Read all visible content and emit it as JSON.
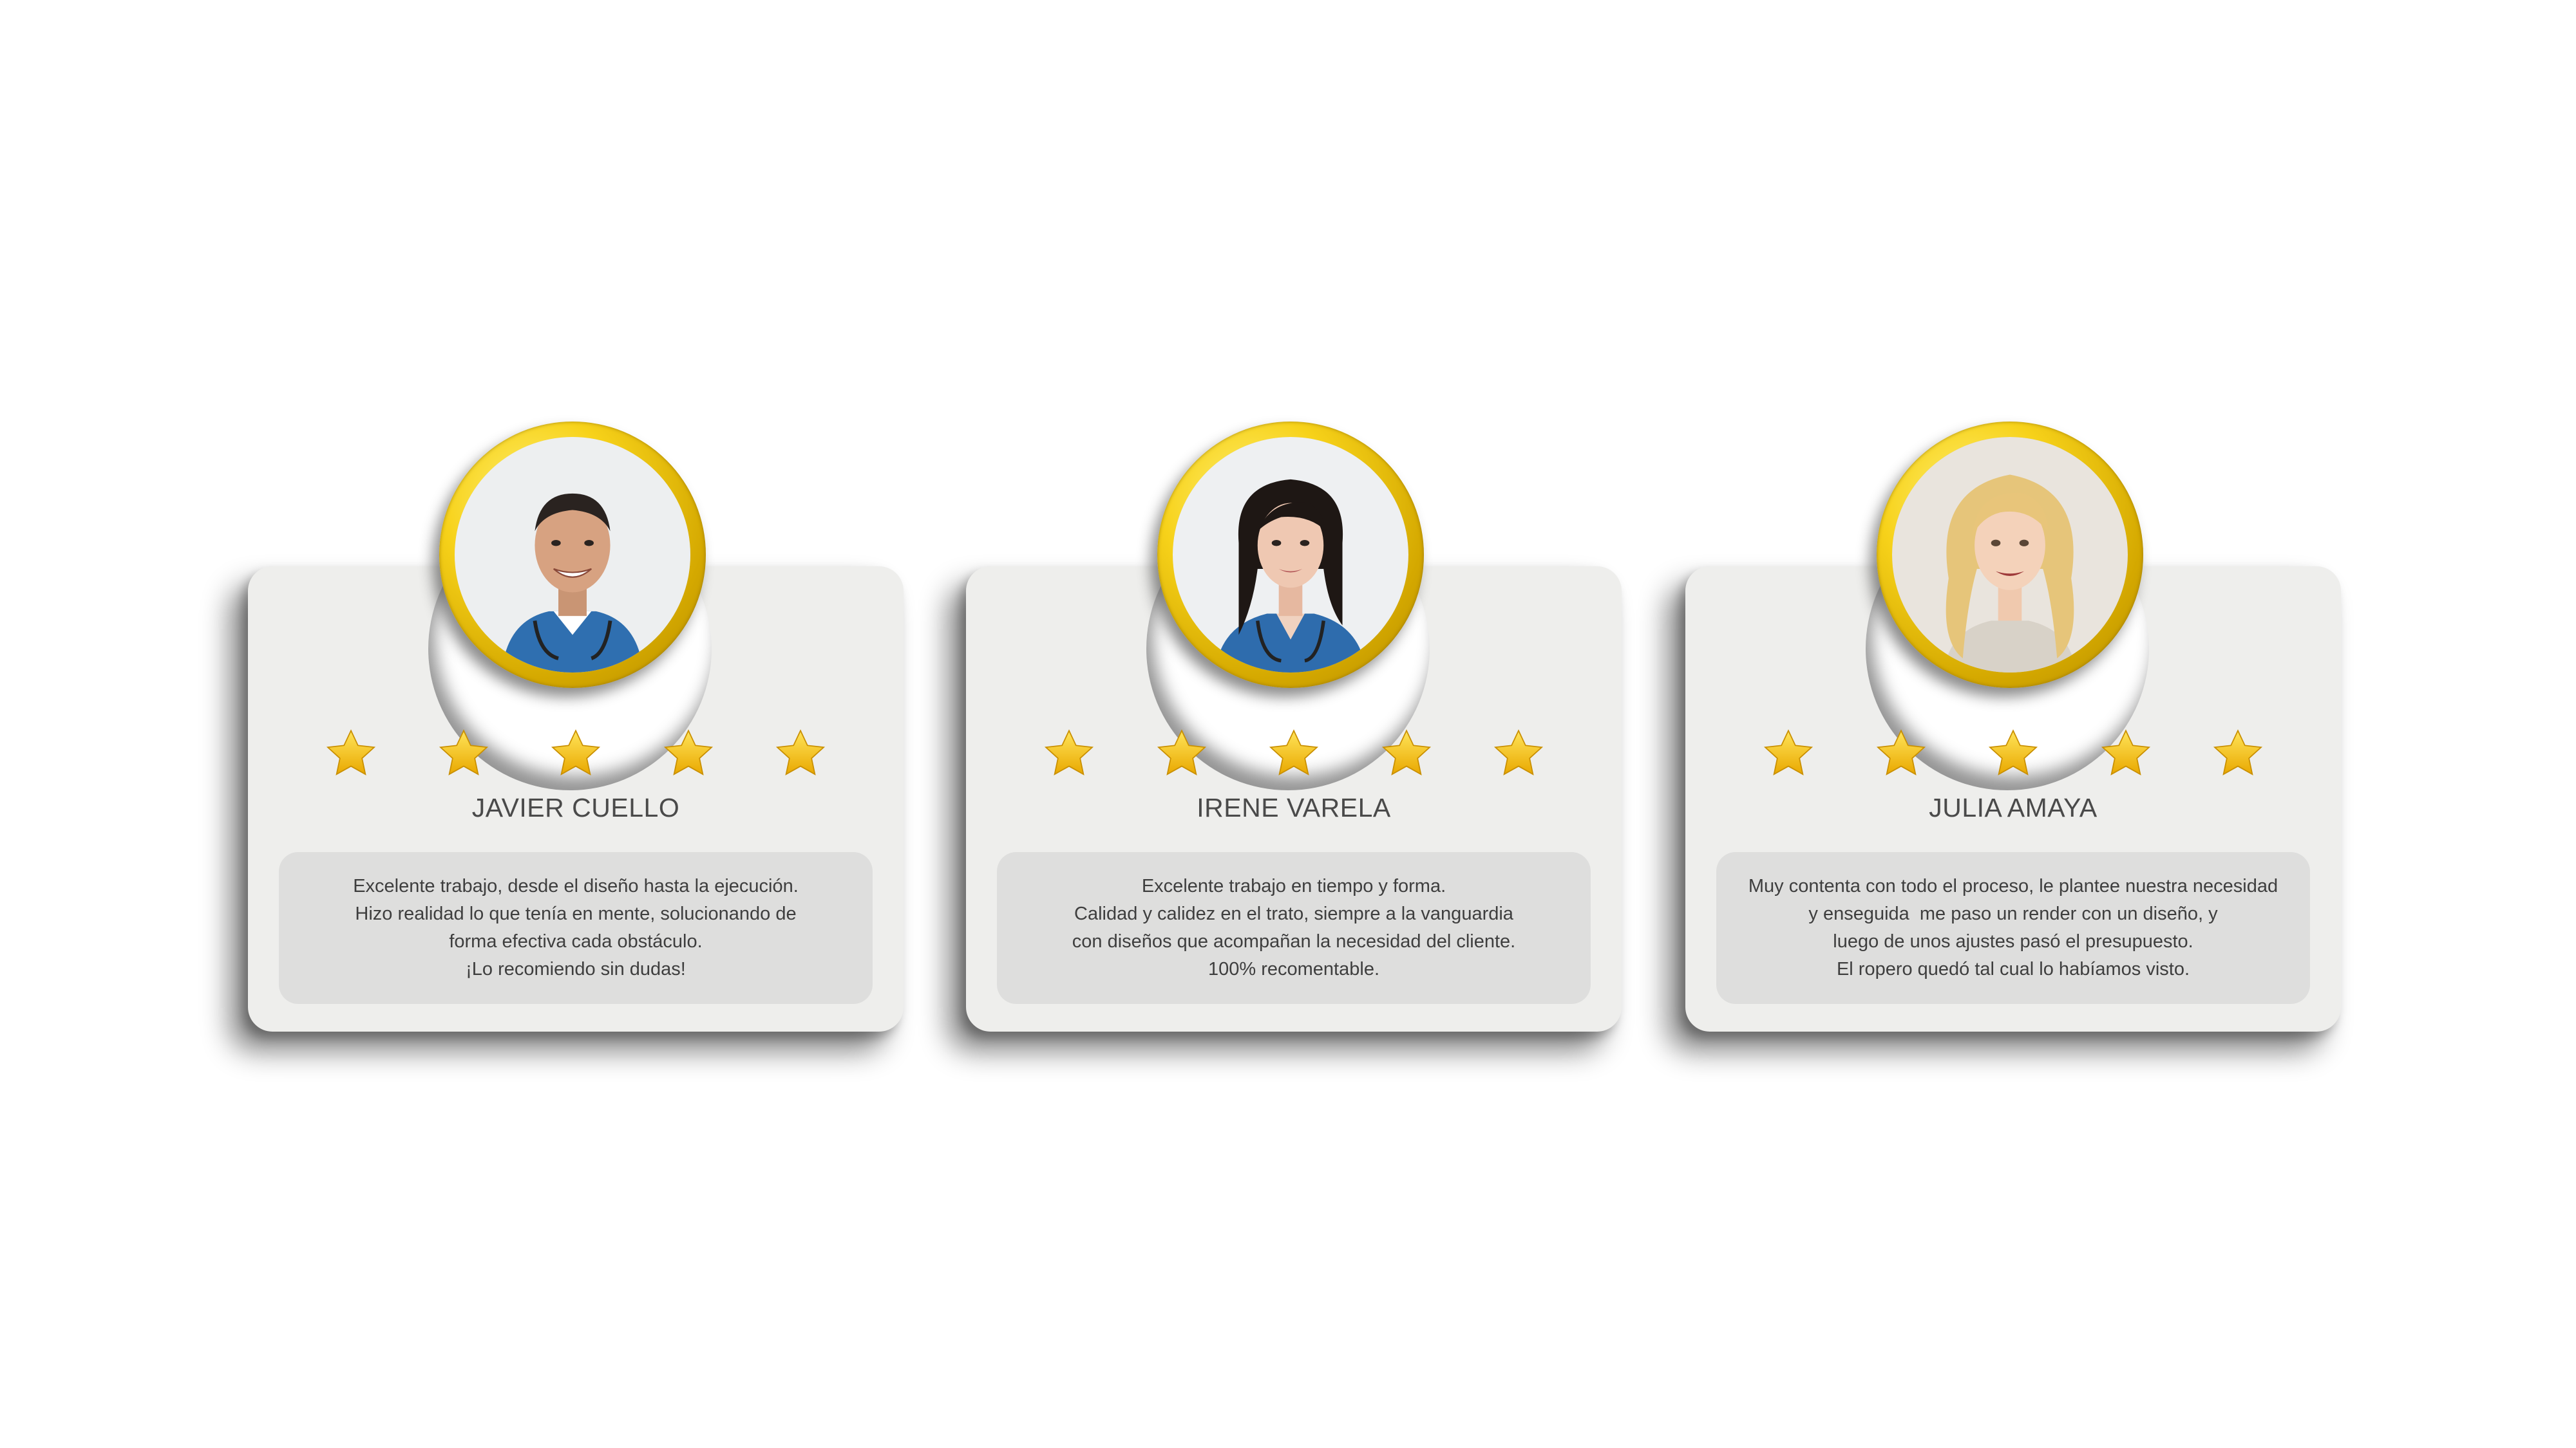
{
  "reviews": [
    {
      "name": "JAVIER CUELLO",
      "rating": 5,
      "avatar_icon": "male-doctor-avatar",
      "text_lines": [
        "Excelente trabajo, desde el diseño hasta la ejecución.",
        "Hizo realidad lo que tenía en mente, solucionando de",
        "forma efectiva cada obstáculo.",
        "¡Lo recomiendo sin dudas!"
      ]
    },
    {
      "name": "IRENE VARELA",
      "rating": 5,
      "avatar_icon": "female-doctor-avatar",
      "text_lines": [
        "Excelente trabajo en tiempo y forma.",
        "Calidad y calidez en el trato, siempre a la vanguardia",
        "con diseños que acompañan la necesidad del cliente.",
        "100% recomentable."
      ]
    },
    {
      "name": "JULIA AMAYA",
      "rating": 5,
      "avatar_icon": "blonde-woman-avatar",
      "text_lines": [
        "Muy contenta con todo el proceso, le plantee nuestra necesidad",
        "y enseguida  me paso un render con un diseño, y",
        "luego de unos ajustes pasó el presupuesto.",
        "El ropero quedó tal cual lo habíamos visto."
      ]
    }
  ],
  "colors": {
    "star": "#f5c400",
    "ring": "#f7d21a",
    "card": "#eeeeec",
    "quote_box": "#dededd",
    "text": "#3e3e3e"
  }
}
